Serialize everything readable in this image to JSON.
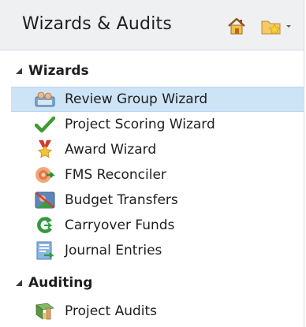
{
  "header": {
    "title": "Wizards & Audits",
    "home_icon": "home-icon",
    "folder_icon": "folder-star-dropdown-icon"
  },
  "sections": [
    {
      "label": "Wizards",
      "expanded": true,
      "items": [
        {
          "label": "Review Group Wizard",
          "icon": "review-group-icon",
          "selected": true
        },
        {
          "label": "Project Scoring Wizard",
          "icon": "checkmark-icon",
          "selected": false
        },
        {
          "label": "Award Wizard",
          "icon": "award-icon",
          "selected": false
        },
        {
          "label": "FMS Reconciler",
          "icon": "fms-reconciler-icon",
          "selected": false
        },
        {
          "label": "Budget Transfers",
          "icon": "budget-transfers-icon",
          "selected": false
        },
        {
          "label": "Carryover Funds",
          "icon": "carryover-icon",
          "selected": false
        },
        {
          "label": "Journal Entries",
          "icon": "journal-entries-icon",
          "selected": false
        }
      ]
    },
    {
      "label": "Auditing",
      "expanded": true,
      "items": [
        {
          "label": "Project Audits",
          "icon": "project-audits-icon",
          "selected": false
        }
      ]
    }
  ],
  "colors": {
    "selection": "#cde4f7",
    "header_bg": "#eef0f2"
  }
}
